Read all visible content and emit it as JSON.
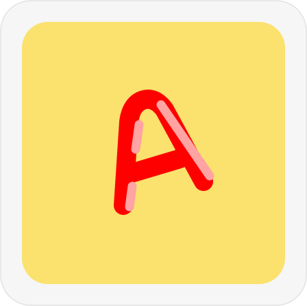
{
  "icon": {
    "letter": "A",
    "colors": {
      "frame": "#f6f6f6",
      "frame_border": "#e2e2e2",
      "tile": "#fbe16d",
      "letter": "#ff0000",
      "highlight": "#ffa3a3"
    }
  }
}
